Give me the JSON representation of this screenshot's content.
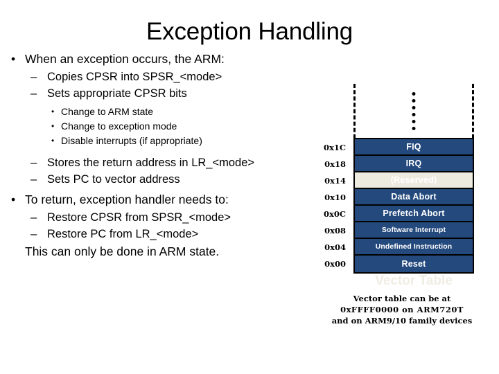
{
  "slide": {
    "title": "Exception Handling"
  },
  "body": {
    "b1": "When an exception occurs, the ARM:",
    "b1_s1": "Copies CPSR into SPSR_<mode>",
    "b1_s2": "Sets appropriate CPSR bits",
    "b1_s2_i1": "Change to ARM state",
    "b1_s2_i2": "Change to exception mode",
    "b1_s2_i3": "Disable interrupts (if appropriate)",
    "b1_s3": "Stores the return address in LR_<mode>",
    "b1_s4": "Sets PC to vector address",
    "b2": "To return, exception handler needs to:",
    "b2_s1": "Restore CPSR from SPSR_<mode>",
    "b2_s2": "Restore PC from LR_<mode>",
    "closing": "This can only be done in ARM state.",
    "bullet_lvl1": "•",
    "bullet_lvl2": "–",
    "bullet_lvl3": "•"
  },
  "vector_table": {
    "caption": "Vector Table",
    "caption_color": "#efede3",
    "row_color": "#244a7d",
    "reserved_color": "#edebe0",
    "rows": [
      {
        "address": "0x1C",
        "label": "FIQ",
        "reserved": false,
        "tight": false
      },
      {
        "address": "0x18",
        "label": "IRQ",
        "reserved": false,
        "tight": false
      },
      {
        "address": "0x14",
        "label": "(Reserved)",
        "reserved": true,
        "tight": false
      },
      {
        "address": "0x10",
        "label": "Data Abort",
        "reserved": false,
        "tight": false
      },
      {
        "address": "0x0C",
        "label": "Prefetch Abort",
        "reserved": false,
        "tight": false
      },
      {
        "address": "0x08",
        "label": "Software Interrupt",
        "reserved": false,
        "tight": true
      },
      {
        "address": "0x04",
        "label": "Undefined Instruction",
        "reserved": false,
        "tight": true
      },
      {
        "address": "0x00",
        "label": "Reset",
        "reserved": false,
        "tight": false
      }
    ],
    "ellipsis_dot_count": 6,
    "note_line1": "Vector table can be at",
    "note_line2": "0xFFFF0000 on ARM720T",
    "note_line3": "and on ARM9/10 family devices"
  }
}
